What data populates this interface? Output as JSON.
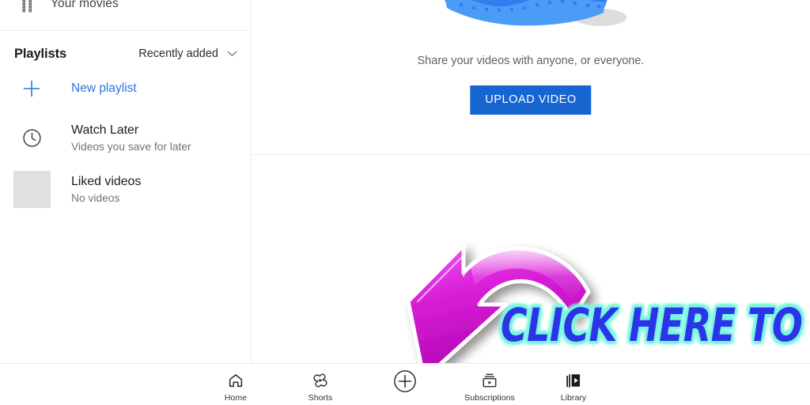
{
  "sidebar": {
    "your_movies": {
      "label": "Your movies",
      "icon": "film-strip-icon"
    },
    "playlists_title": "Playlists",
    "sort": {
      "label": "Recently added",
      "icon": "chevron-down-icon"
    },
    "new_playlist": {
      "label": "New playlist",
      "icon": "plus-icon",
      "color": "#2a75e0"
    },
    "playlists": [
      {
        "title": "Watch Later",
        "subtitle": "Videos you save for later",
        "icon": "clock-icon"
      },
      {
        "title": "Liked videos",
        "subtitle": "No videos",
        "icon": "thumbnail-placeholder"
      }
    ]
  },
  "main": {
    "illustration": "share-videos-illustration",
    "caption": "Share your videos with anyone, or everyone.",
    "upload_button": {
      "label": "UPLOAD VIDEO",
      "color": "#1765d1"
    }
  },
  "overlay": {
    "arrow": {
      "name": "curved-arrow-annotation",
      "color": "#d61ad6"
    },
    "text": "CLICK HERE TO UPLOAD",
    "text_color": "#2b35e8",
    "glow_color": "#7bf5df"
  },
  "bottom_nav": {
    "items": [
      {
        "label": "Home",
        "icon": "home-icon",
        "active": false
      },
      {
        "label": "Shorts",
        "icon": "shorts-icon",
        "active": false
      },
      {
        "label": "",
        "icon": "create-plus-icon",
        "active": false
      },
      {
        "label": "Subscriptions",
        "icon": "subscriptions-icon",
        "active": false
      },
      {
        "label": "Library",
        "icon": "library-icon",
        "active": true
      }
    ]
  },
  "colors": {
    "accent_blue": "#2a75e0",
    "button_blue": "#1765d1",
    "divider": "#ececec",
    "text_primary": "#1d1d1d",
    "text_secondary": "#737373"
  }
}
